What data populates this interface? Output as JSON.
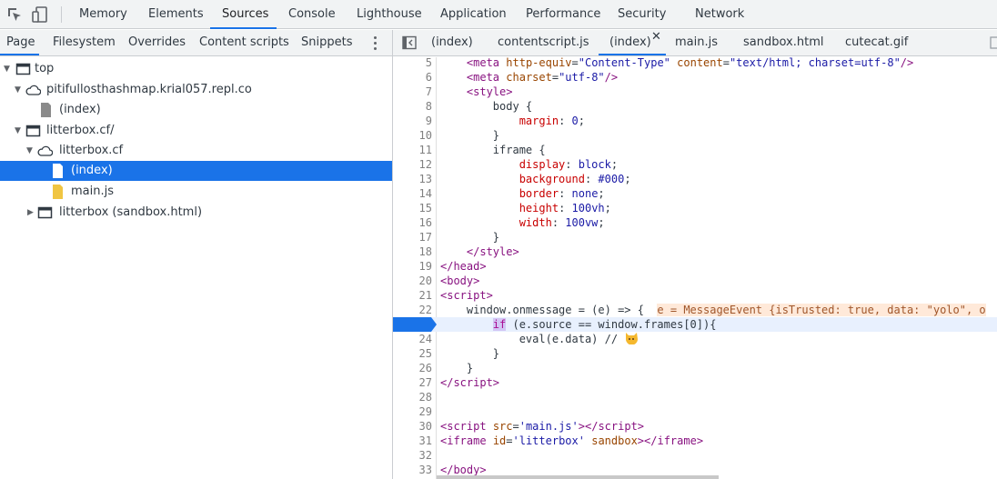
{
  "toolbar": {
    "inspect_icon": "inspect-element-icon",
    "device_icon": "device-toolbar-icon",
    "tabs": [
      "Memory",
      "Elements",
      "Sources",
      "Console",
      "Lighthouse",
      "Application",
      "Performance",
      "Security",
      "Network"
    ],
    "active_tab": "Sources"
  },
  "navigator": {
    "tabs": [
      "Page",
      "Filesystem",
      "Overrides",
      "Content scripts",
      "Snippets"
    ],
    "active_tab": "Page",
    "tree": [
      {
        "label": "top",
        "icon": "frame-icon"
      },
      {
        "label": "pitifullosthashmap.krial057.repl.co",
        "icon": "cloud-icon"
      },
      {
        "label": "(index)",
        "icon": "file-icon"
      },
      {
        "label": "litterbox.cf/",
        "icon": "frame-icon"
      },
      {
        "label": "litterbox.cf",
        "icon": "cloud-icon"
      },
      {
        "label": "(index)",
        "icon": "file-icon",
        "selected": true
      },
      {
        "label": "main.js",
        "icon": "js-file-icon"
      },
      {
        "label": "litterbox (sandbox.html)",
        "icon": "frame-icon"
      }
    ]
  },
  "editor": {
    "tabs": [
      "(index)",
      "contentscript.js",
      "(index)",
      "main.js",
      "sandbox.html",
      "cutecat.gif"
    ],
    "active_tab_index": 2,
    "close_glyph": "✕",
    "lines": [
      {
        "n": "5"
      },
      {
        "n": "6"
      },
      {
        "n": "7"
      },
      {
        "n": "8"
      },
      {
        "n": "9"
      },
      {
        "n": "10"
      },
      {
        "n": "11"
      },
      {
        "n": "12"
      },
      {
        "n": "13"
      },
      {
        "n": "14"
      },
      {
        "n": "15"
      },
      {
        "n": "16"
      },
      {
        "n": "17"
      },
      {
        "n": "18"
      },
      {
        "n": "19"
      },
      {
        "n": "20"
      },
      {
        "n": "21"
      },
      {
        "n": "22"
      },
      {
        "n": "23"
      },
      {
        "n": "24"
      },
      {
        "n": "25"
      },
      {
        "n": "26"
      },
      {
        "n": "27"
      },
      {
        "n": "28"
      },
      {
        "n": "29"
      },
      {
        "n": "30"
      },
      {
        "n": "31"
      },
      {
        "n": "32"
      },
      {
        "n": "33"
      }
    ],
    "inline_value": "e = MessageEvent {isTrusted: true, data: \"yolo\", o",
    "breakpoint_line": "23"
  },
  "colors": {
    "accent": "#1a73e8",
    "breakpoint_bg": "#e8f0fe",
    "inline_value_bg": "#ffe9d9"
  }
}
